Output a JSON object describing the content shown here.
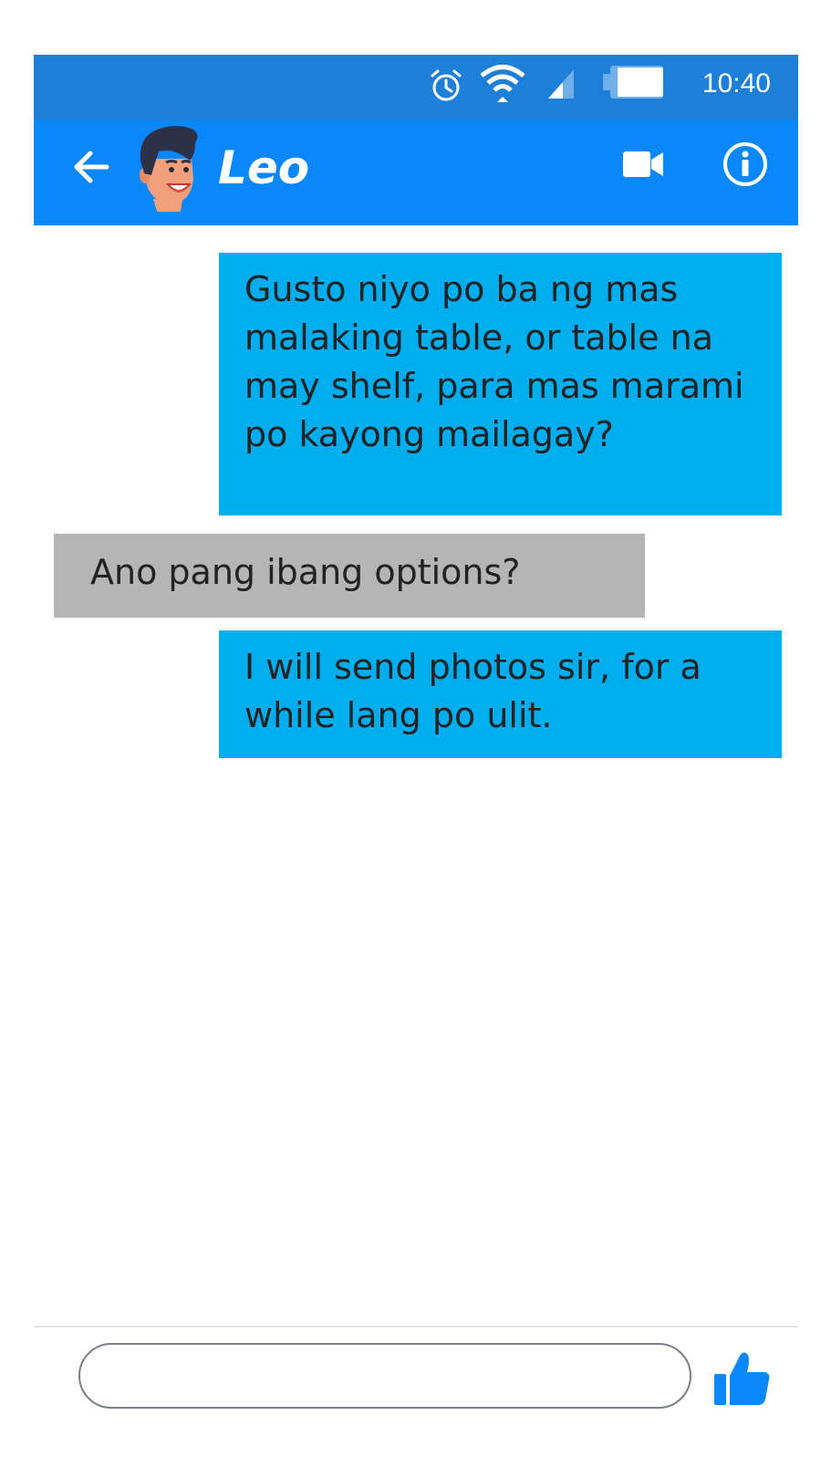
{
  "status_bar": {
    "time": "10:40",
    "icons": [
      "alarm-icon",
      "wifi-icon",
      "cell-signal-icon",
      "battery-icon"
    ]
  },
  "header": {
    "contact_name": "Leo",
    "icons": [
      "back-arrow-icon",
      "avatar",
      "video-camera-icon",
      "info-icon"
    ]
  },
  "messages": [
    {
      "direction": "outgoing",
      "text": "Gusto niyo po ba ng mas malaking table, or table na may shelf, para mas marami po kayong mailagay?"
    },
    {
      "direction": "incoming",
      "text": "Ano pang ibang options?"
    },
    {
      "direction": "outgoing",
      "text": "I will send photos sir, for a while lang po ulit."
    }
  ],
  "composer": {
    "placeholder": "",
    "value": "",
    "send_icon": "thumbs-up-icon"
  },
  "colors": {
    "status_bar": "#1e7fd8",
    "app_bar": "#0a87fa",
    "outgoing_bubble": "#00aef0",
    "incoming_bubble": "#b5b5b5",
    "like": "#0a87fa"
  }
}
